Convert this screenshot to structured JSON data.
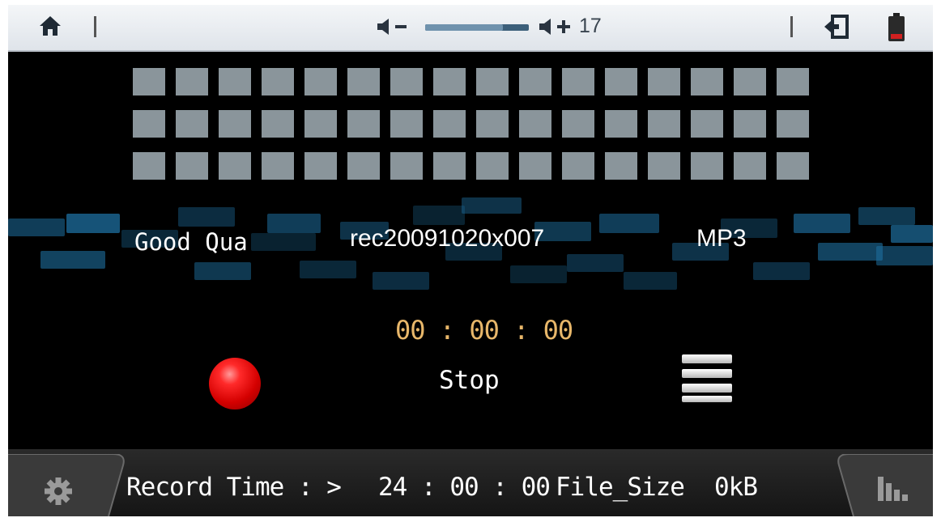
{
  "status_bar": {
    "volume_level": "17",
    "volume_fraction": 0.75,
    "icons": [
      "home-icon",
      "volume-down-icon",
      "volume-up-icon",
      "exit-icon",
      "battery-icon"
    ]
  },
  "meter": {
    "rows": 3,
    "columns": 16,
    "cell_color": "#8a959b"
  },
  "recording": {
    "quality": "Good Qua",
    "filename": "rec20091020x007",
    "format": "MP3",
    "timer": "00 : 00 : 00",
    "stop_label": "Stop"
  },
  "footer": {
    "record_time_label": "Record Time : >",
    "record_time_value": "24 : 00 : 00",
    "file_size_label": "File_Size",
    "file_size_value": "0kB"
  },
  "colors": {
    "screen_bg": "#000000",
    "status_bar_bg": "#dfe4ea",
    "timer": "#e8b76a",
    "record": "#e00000",
    "accent_blue": "#1e6fa0"
  }
}
